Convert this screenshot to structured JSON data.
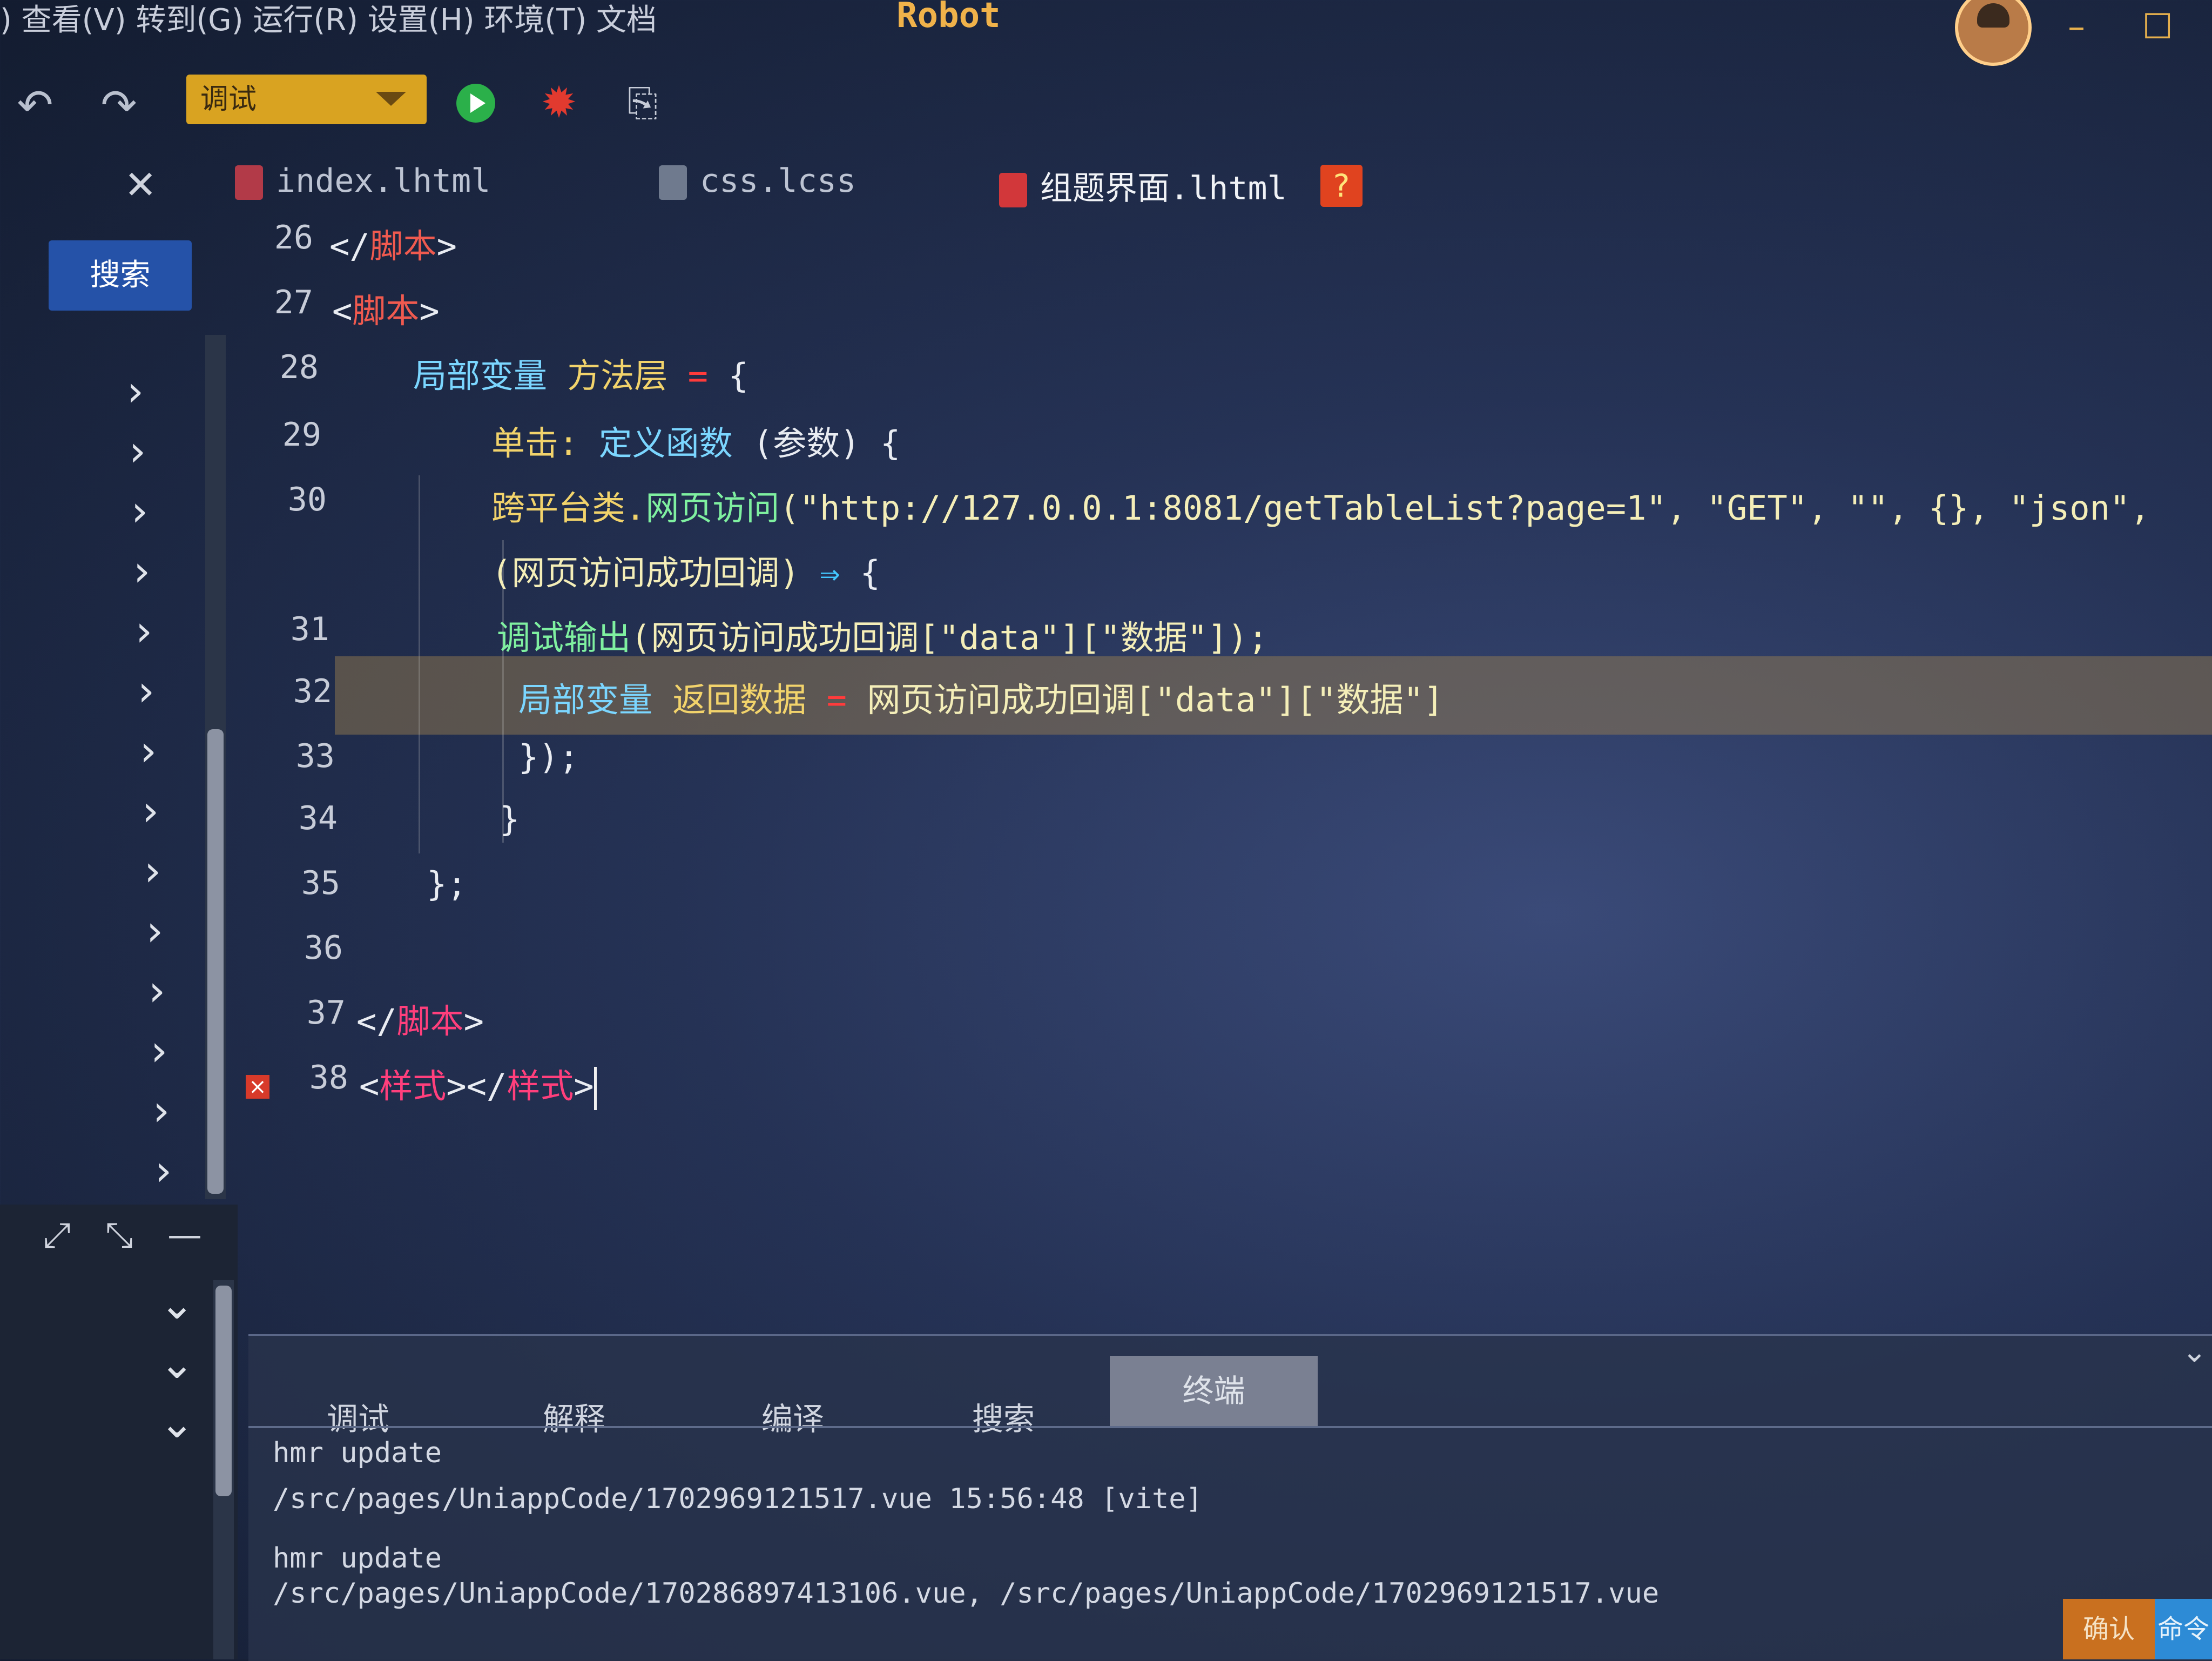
{
  "menubar": {
    "menu_text": ") 查看(V) 转到(G) 运行(R) 设置(H) 环境(T) 文档",
    "app_title": "Robot"
  },
  "toolbar": {
    "mode_select_value": "调试"
  },
  "tabs": [
    {
      "label": "index.lhtml"
    },
    {
      "label": "css.lcss"
    },
    {
      "label": "组题界面.lhtml"
    }
  ],
  "tab_badge": "?",
  "sidebar": {
    "search_button": "搜索"
  },
  "editor": {
    "lines": [
      {
        "num": "26",
        "tokens": [
          {
            "t": "</",
            "c": "c-white"
          },
          {
            "t": "脚本",
            "c": "c-red"
          },
          {
            "t": ">",
            "c": "c-white"
          }
        ]
      },
      {
        "num": "27",
        "tokens": [
          {
            "t": "<",
            "c": "c-white"
          },
          {
            "t": "脚本",
            "c": "c-red"
          },
          {
            "t": ">",
            "c": "c-white"
          }
        ]
      },
      {
        "num": "28",
        "tokens": [
          {
            "t": "局部变量 ",
            "c": "c-kw"
          },
          {
            "t": "方法层 ",
            "c": "c-yellow"
          },
          {
            "t": "= ",
            "c": "c-op"
          },
          {
            "t": "{",
            "c": "c-white"
          }
        ]
      },
      {
        "num": "29",
        "tokens": [
          {
            "t": "单击: ",
            "c": "c-yellow"
          },
          {
            "t": "定义函数 ",
            "c": "c-kw"
          },
          {
            "t": "(参数) {",
            "c": "c-white"
          }
        ]
      },
      {
        "num": "30",
        "tokens": [
          {
            "t": "跨平台类.",
            "c": "c-yellow"
          },
          {
            "t": "网页访问",
            "c": "c-green"
          },
          {
            "t": "(\"http://127.0.0.1:8081/getTableList?page=1\", \"GET\", \"\", {}, \"json\",",
            "c": "c-str"
          }
        ]
      },
      {
        "num": "",
        "tokens": [
          {
            "t": "(网页访问成功回调) ",
            "c": "c-str"
          },
          {
            "t": "⇒ ",
            "c": "c-arrow"
          },
          {
            "t": "{",
            "c": "c-white"
          }
        ]
      },
      {
        "num": "31",
        "tokens": [
          {
            "t": "调试输出",
            "c": "c-green"
          },
          {
            "t": "(网页访问成功回调",
            "c": "c-str"
          },
          {
            "t": "[\"data\"][\"数据\"]);",
            "c": "c-str"
          }
        ]
      },
      {
        "num": "32",
        "tokens": [
          {
            "t": "局部变量 ",
            "c": "c-kw"
          },
          {
            "t": "返回数据 ",
            "c": "c-yellow"
          },
          {
            "t": "= ",
            "c": "c-op"
          },
          {
            "t": "网页访问成功回调",
            "c": "c-str"
          },
          {
            "t": "[\"data\"][\"数据\"]",
            "c": "c-str"
          }
        ]
      },
      {
        "num": "33",
        "tokens": [
          {
            "t": "});",
            "c": "c-white"
          }
        ]
      },
      {
        "num": "34",
        "tokens": [
          {
            "t": "}",
            "c": "c-white"
          }
        ]
      },
      {
        "num": "35",
        "tokens": [
          {
            "t": "};",
            "c": "c-white"
          }
        ]
      },
      {
        "num": "36",
        "tokens": []
      },
      {
        "num": "37",
        "tokens": [
          {
            "t": "</",
            "c": "c-white"
          },
          {
            "t": "脚本",
            "c": "c-pink"
          },
          {
            "t": ">",
            "c": "c-white"
          }
        ]
      },
      {
        "num": "38",
        "tokens": [
          {
            "t": "<",
            "c": "c-white"
          },
          {
            "t": "样式",
            "c": "c-pink"
          },
          {
            "t": "></",
            "c": "c-white"
          },
          {
            "t": "样式",
            "c": "c-pink"
          },
          {
            "t": ">",
            "c": "c-white"
          }
        ]
      }
    ],
    "error_marker": "×"
  },
  "panel": {
    "tabs": [
      "调试",
      "解释",
      "编译",
      "搜索"
    ],
    "active_tab": "终端",
    "terminal_lines": [
      "hmr update",
      "/src/pages/UniappCode/1702969121517.vue 15:56:48 [vite]",
      "hmr update",
      "/src/pages/UniappCode/170286897413106.vue, /src/pages/UniappCode/1702969121517.vue"
    ]
  },
  "statusbar": {
    "confirm": "确认",
    "command": "命令"
  },
  "colors": {
    "background": "#253255",
    "accent_gold": "#d9a321",
    "run_green": "#2bb04a",
    "error_red": "#d83a2a",
    "search_blue": "#2552a8"
  },
  "icons": [
    "undo-icon",
    "redo-icon",
    "run-icon",
    "debug-bug-icon",
    "document-search-icon",
    "close-icon",
    "chevron-right-icon",
    "chevron-down-icon",
    "expand-icon",
    "shrink-icon",
    "minimize-icon",
    "maximize-icon"
  ]
}
